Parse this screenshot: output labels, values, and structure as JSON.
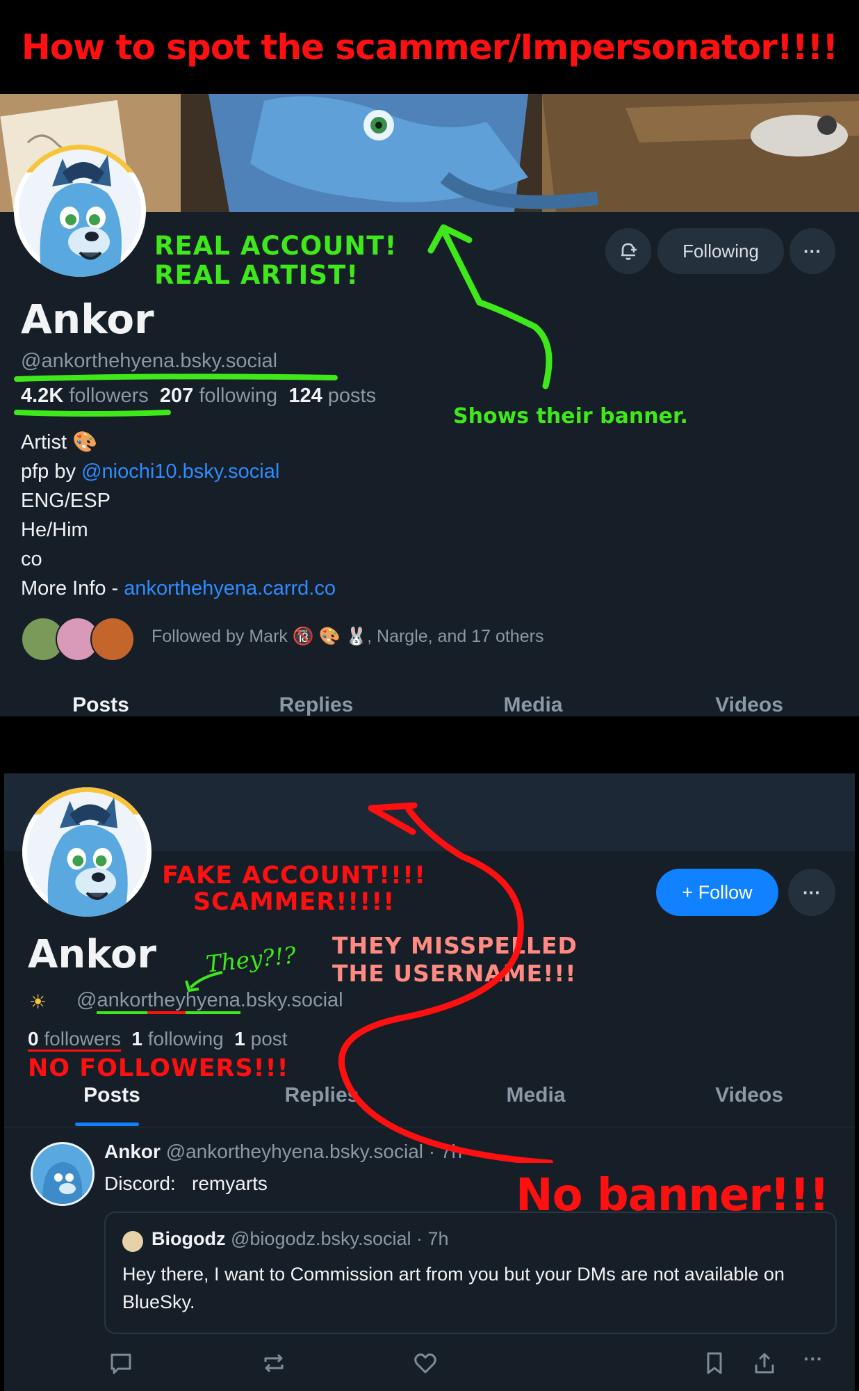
{
  "header": {
    "title": "How to spot the scammer/Impersonator!!!!"
  },
  "real_profile": {
    "annotation": [
      "REAL ACCOUNT!",
      "REAL ARTIST!"
    ],
    "banner_note": "Shows their banner.",
    "bell_label": "",
    "following_button": "Following",
    "more_label": "···",
    "display_name": "Ankor",
    "handle": "@ankorthehyena.bsky.social",
    "followers_count": "4.2K",
    "followers_label": "followers",
    "following_count": "207",
    "following_label": "following",
    "posts_count": "124",
    "posts_label": "posts",
    "bio": {
      "line1": "Artist",
      "line2_prefix": "pfp by ",
      "line2_link": "@niochi10.bsky.social",
      "line3": "ENG/ESP",
      "line4": "He/Him",
      "line5": "co",
      "line6_prefix": "More Info - ",
      "line6_link": "ankorthehyena.carrd.co"
    },
    "followed_by": "Followed by Mark 🔞 🎨 🐰, Nargle, and 17 others",
    "tabs": [
      "Posts",
      "Replies",
      "Media",
      "Videos"
    ]
  },
  "fake_profile": {
    "annotation": [
      "FAKE ACCOUNT!!!!",
      "SCAMMER!!!!!"
    ],
    "misspell_note": [
      "THEY MISSPELLED",
      "THE USERNAME!!!"
    ],
    "handwriting": "They?!?",
    "follow_button": "+ Follow",
    "more_label": "···",
    "display_name": "Ankor",
    "handle_at": "@",
    "handle_part1": "ankor",
    "handle_part2": "they",
    "handle_part3": "hyena",
    "handle_suffix": ".bsky.social",
    "followers_count": "0",
    "followers_label": "followers",
    "following_count": "1",
    "following_label": "following",
    "posts_count": "1",
    "posts_label": "post",
    "no_followers_note": "NO FOLLOWERS!!!",
    "no_banner_note": "No banner!!!",
    "tabs": [
      "Posts",
      "Replies",
      "Media",
      "Videos"
    ],
    "post": {
      "author": "Ankor",
      "handle": "@ankortheyhyena.bsky.social · 7h",
      "text": "Discord:   remyarts",
      "quote": {
        "author": "Biogodz",
        "handle": "@biogodz.bsky.social · 7h",
        "text": "Hey there, I want to Commission art from you but your DMs are not available on BlueSky."
      }
    }
  },
  "colors": {
    "red_annotation": "#ff1010",
    "green_annotation": "#3ee81a",
    "accent_blue": "#1081ff",
    "panel_bg": "#161e27"
  },
  "icons": [
    "bell-plus-icon",
    "more-icon",
    "reply-icon",
    "repost-icon",
    "like-icon",
    "bookmark-icon",
    "share-icon"
  ]
}
